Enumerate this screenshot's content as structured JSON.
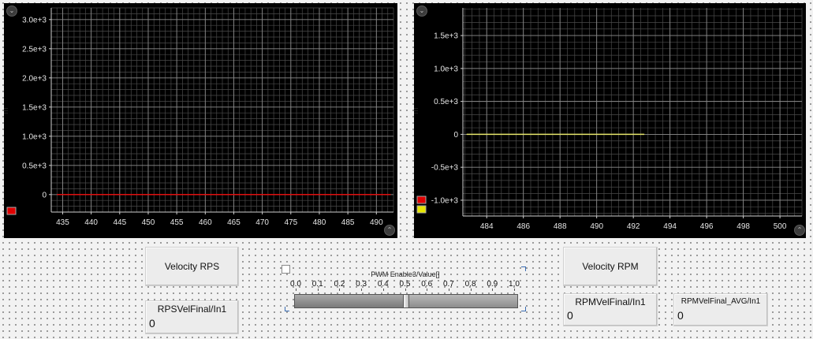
{
  "chart_data": [
    {
      "type": "line",
      "xlim": [
        433,
        493
      ],
      "xticks": [
        "435",
        "440",
        "445",
        "450",
        "455",
        "460",
        "465",
        "470",
        "475",
        "480",
        "485",
        "490"
      ],
      "xtick_values": [
        435,
        440,
        445,
        450,
        455,
        460,
        465,
        470,
        475,
        480,
        485,
        490
      ],
      "ylim": [
        -300,
        3200
      ],
      "yticks": [
        "3.0e+3",
        "2.5e+3",
        "2.0e+3",
        "1.5e+3",
        "1.0e+3",
        "0.5e+3",
        "0"
      ],
      "ytick_values": [
        3000,
        2500,
        2000,
        1500,
        1000,
        500,
        0
      ],
      "grid": true,
      "series": [
        {
          "color": "#e01010",
          "x": [
            434,
            492.5
          ],
          "y": [
            0,
            0
          ]
        }
      ],
      "legend_colors": [
        "#e00000"
      ]
    },
    {
      "type": "line",
      "xlim": [
        482.7,
        501.2
      ],
      "xticks": [
        "484",
        "486",
        "488",
        "490",
        "492",
        "494",
        "496",
        "498",
        "500"
      ],
      "xtick_values": [
        484,
        486,
        488,
        490,
        492,
        494,
        496,
        498,
        500
      ],
      "ylim": [
        -1240,
        1920
      ],
      "yticks": [
        "1.5e+3",
        "1.0e+3",
        "0.5e+3",
        "0",
        "-0.5e+3",
        "-1.0e+3"
      ],
      "ytick_values": [
        1500,
        1000,
        500,
        0,
        -500,
        -1000
      ],
      "grid": true,
      "series": [
        {
          "color": "#e5e56a",
          "x": [
            482.9,
            492.6
          ],
          "y": [
            0,
            0
          ]
        }
      ],
      "legend_colors": [
        "#e00000",
        "#e6e600"
      ]
    }
  ],
  "controls": {
    "velocity_rps_button": "Velocity RPS",
    "velocity_rpm_button": "Velocity RPM",
    "rps_display": {
      "label": "RPSVelFinal/In1",
      "value": "0"
    },
    "rpm_display": {
      "label": "RPMVelFinal/In1",
      "value": "0"
    },
    "rpm_avg_display": {
      "label": "RPMVelFinal_AVG/In1",
      "value": "0"
    },
    "pwm_slider": {
      "title": "PWM Enable3/Value[]",
      "ticks": [
        "0.0",
        "0.1",
        "0.2",
        "0.3",
        "0.4",
        "0.5",
        "0.6",
        "0.7",
        "0.8",
        "0.9",
        "1.0"
      ],
      "value": 0.5
    }
  }
}
